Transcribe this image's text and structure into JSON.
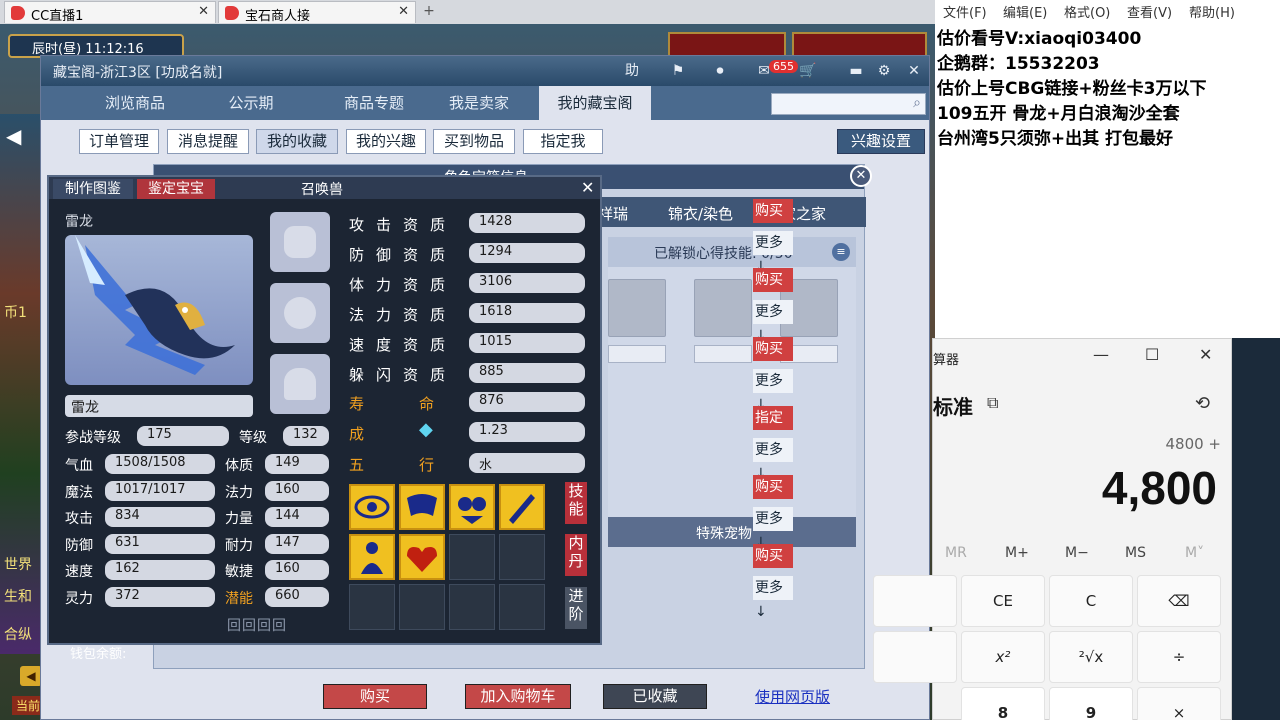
{
  "browser": {
    "tabs": [
      {
        "title": "CC直播1"
      },
      {
        "title": "宝石商人接"
      }
    ]
  },
  "game": {
    "clock": "辰时(昼) 11:12:16",
    "left_labels": [
      "币1",
      "生和",
      "合纵",
      "世界"
    ],
    "current_tag": "当前",
    "count_tag": "3+",
    "wallet_label": "钱包余额:"
  },
  "window": {
    "title": "藏宝阁-浙江3区 [功成名就]",
    "header_icons": [
      "助",
      "⚑",
      "⏺"
    ],
    "cart_badge": "655",
    "nav_tabs": [
      "浏览商品",
      "公示期",
      "商品专题",
      "我是卖家",
      "我的藏宝阁"
    ],
    "active_nav": 4,
    "sub_tabs": [
      "订单管理",
      "消息提醒",
      "我的收藏",
      "我的兴趣",
      "买到物品",
      "指定我"
    ],
    "active_sub": 2,
    "interest_button": "兴趣设置",
    "back_panel": {
      "title": "角色宝箱信息",
      "tabs": [
        "祥瑞",
        "锦衣/染色",
        "玩家之家"
      ],
      "skill_header": "已解锁心得技能: 0/50",
      "special_header": "特殊宠物",
      "right_buttons": [
        "购买",
        "更多↓",
        "购买",
        "更多↓",
        "购买",
        "更多↓",
        "指定",
        "更多↓",
        "购买",
        "更多↓",
        "购买",
        "更多↓"
      ]
    },
    "bottom_buttons": {
      "buy": "购买",
      "add_cart": "加入购物车",
      "collected": "已收藏",
      "web": "使用网页版"
    }
  },
  "pet": {
    "tab_handbook": "制作图鉴",
    "tab_appraise": "鉴定宝宝",
    "title": "召唤兽",
    "name_top": "雷龙",
    "name": "雷龙",
    "battle_level_label": "参战等级",
    "battle_level": "175",
    "level_label": "等级",
    "level": "132",
    "stats_left": [
      {
        "label": "气血",
        "value": "1508/1508"
      },
      {
        "label": "魔法",
        "value": "1017/1017"
      },
      {
        "label": "攻击",
        "value": "834"
      },
      {
        "label": "防御",
        "value": "631"
      },
      {
        "label": "速度",
        "value": "162"
      },
      {
        "label": "灵力",
        "value": "372"
      }
    ],
    "stats_right": [
      {
        "label": "体质",
        "value": "149"
      },
      {
        "label": "法力",
        "value": "160"
      },
      {
        "label": "力量",
        "value": "144"
      },
      {
        "label": "耐力",
        "value": "147"
      },
      {
        "label": "敏捷",
        "value": "160"
      },
      {
        "label": "潜能",
        "value": "660"
      }
    ],
    "qualities": [
      {
        "label": "攻击资质",
        "value": "1428"
      },
      {
        "label": "防御资质",
        "value": "1294"
      },
      {
        "label": "体力资质",
        "value": "3106"
      },
      {
        "label": "法力资质",
        "value": "1618"
      },
      {
        "label": "速度资质",
        "value": "1015"
      },
      {
        "label": "躲闪资质",
        "value": "885"
      }
    ],
    "lifespan_label": "寿命",
    "lifespan": "876",
    "growth_label": "成",
    "growth": "1.23",
    "element_label": "五行",
    "element": "水",
    "side_buttons": [
      "技能",
      "内丹",
      "进阶"
    ]
  },
  "notepad": {
    "menu": [
      "文件(F)",
      "编辑(E)",
      "格式(O)",
      "查看(V)",
      "帮助(H)"
    ],
    "lines": [
      "估价看号V:xiaoqi03400",
      "企鹅群：15532203",
      "估价上号CBG链接+粉丝卡3万以下",
      "109五开 骨龙+月白浪淘沙全套",
      "台州湾5只须弥+出其 打包最好"
    ]
  },
  "calculator": {
    "title": "算器",
    "mode": "标准",
    "expression": "4800 +",
    "display": "4,800",
    "memory_keys": [
      "MC",
      "MR",
      "M+",
      "M−",
      "MS",
      "M˅"
    ],
    "keys": [
      "CE",
      "C",
      "⌫",
      "x²",
      "²√x",
      "÷",
      "8",
      "9",
      "×"
    ]
  }
}
